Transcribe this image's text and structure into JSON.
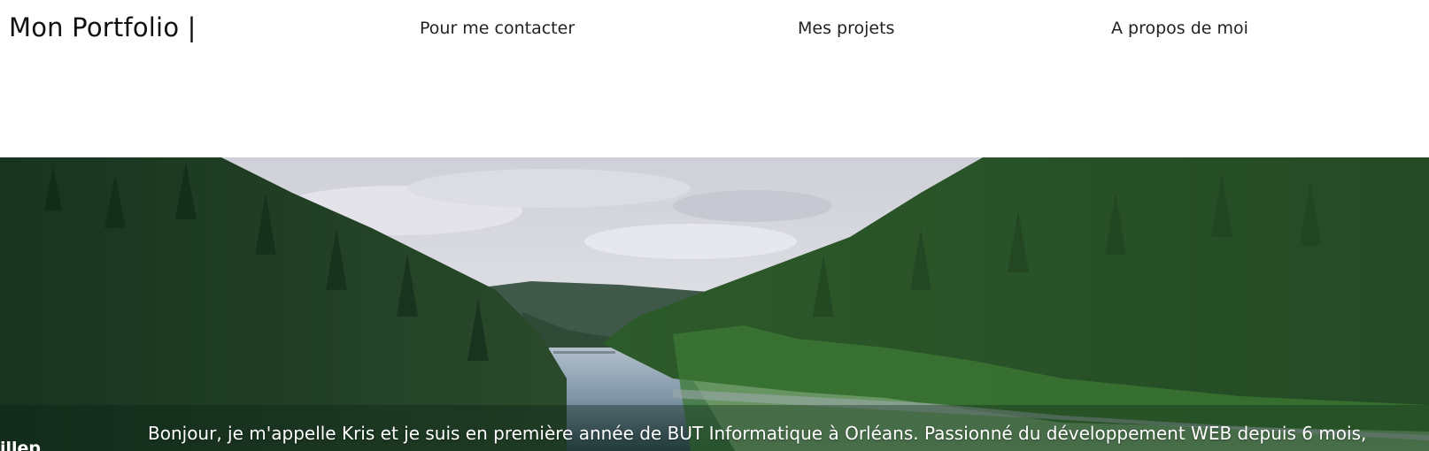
{
  "header": {
    "brand": "Mon Portfolio  |",
    "nav": [
      {
        "label": "Pour me contacter"
      },
      {
        "label": "Mes projets"
      },
      {
        "label": "A propos de moi"
      }
    ]
  },
  "hero": {
    "image": "forest-lake-valley-photo",
    "intro": "Bonjour, je m'appelle Kris et je suis en première année de BUT Informatique à Orléans. Passionné du développement WEB depuis 6 mois,",
    "corner_text": "illep"
  },
  "colors": {
    "background": "#ffffff",
    "text": "#1a1a1a",
    "hero_text": "#ffffff"
  }
}
